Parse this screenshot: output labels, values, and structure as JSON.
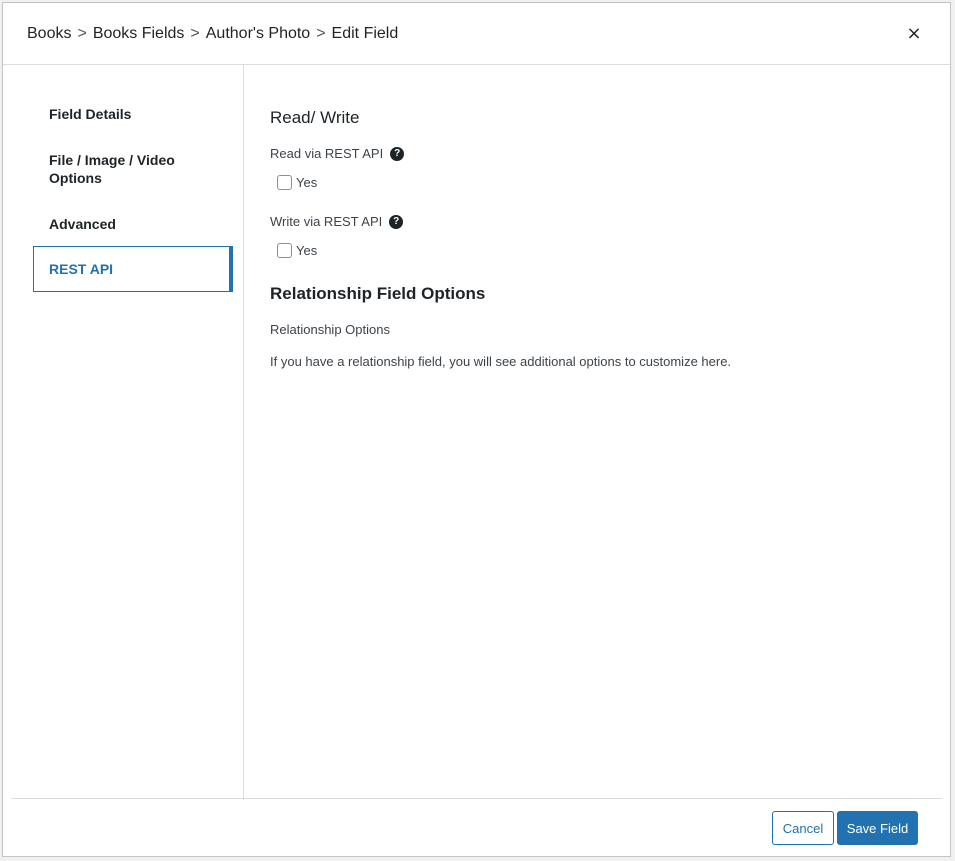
{
  "header": {
    "breadcrumb": [
      "Books",
      "Books Fields",
      "Author's Photo",
      "Edit Field"
    ],
    "separator": ">",
    "close_label": "×"
  },
  "sidebar": {
    "items": [
      {
        "label": "Field Details",
        "active": false
      },
      {
        "label": "File / Image / Video Options",
        "active": false
      },
      {
        "label": "Advanced",
        "active": false
      },
      {
        "label": "REST API",
        "active": true
      }
    ]
  },
  "main": {
    "read_write": {
      "title": "Read/ Write",
      "read_label": "Read via REST API",
      "read_option": "Yes",
      "read_checked": false,
      "write_label": "Write via REST API",
      "write_option": "Yes",
      "write_checked": false,
      "help_icon": "question-circle-icon"
    },
    "relationship": {
      "title": "Relationship Field Options",
      "subtitle": "Relationship Options",
      "description": "If you have a relationship field, you will see additional options to customize here."
    }
  },
  "footer": {
    "cancel_label": "Cancel",
    "save_label": "Save Field"
  },
  "colors": {
    "accent": "#2271b1",
    "text": "#1d2327",
    "border": "#dcdcde"
  }
}
